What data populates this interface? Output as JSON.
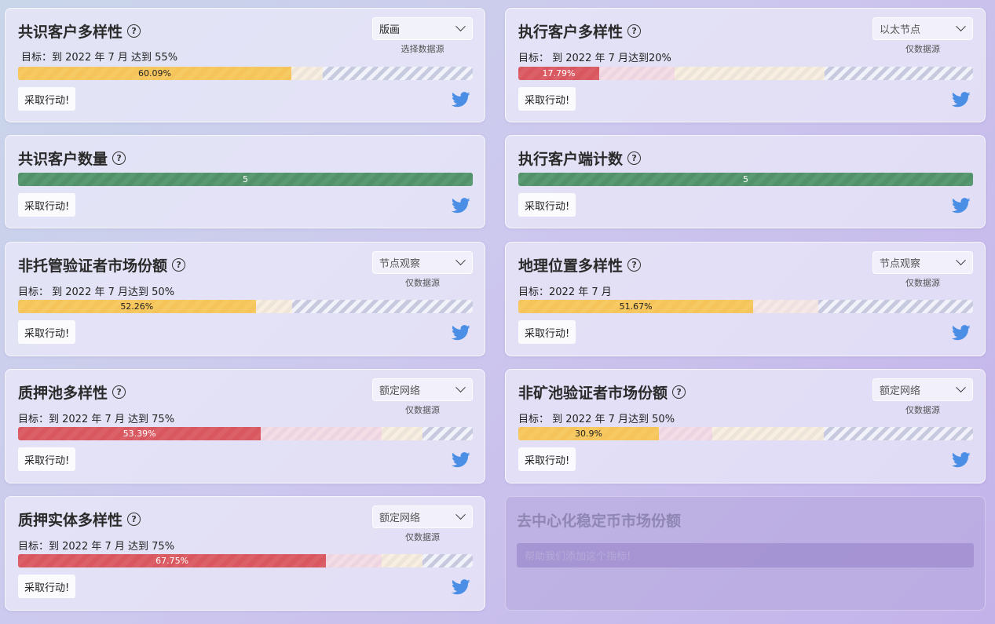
{
  "common": {
    "action_label": "采取行动!",
    "help_glyph": "?"
  },
  "colors": {
    "yellow": "#f5c45a",
    "red": "#d9585f",
    "green": "#53916a",
    "twitter": "#4a8ee6"
  },
  "cards": [
    {
      "title": "共识客户多样性",
      "goal": "目标：到 2022 年 7 月 达到 55%",
      "select": "版画",
      "select_sub": "选择数据源",
      "bar_label": "60.09%",
      "fill_percent": 60.09,
      "color": "yellow"
    },
    {
      "title": "执行客户多样性",
      "goal": "目标： 到 2022 年 7 月达到20%",
      "select": "以太节点",
      "select_sub": "仅数据源",
      "bar_label": "17.79%",
      "fill_percent": 17.79,
      "color": "red"
    },
    {
      "title": "共识客户数量",
      "bar_label": "5",
      "fill_percent": 100,
      "color": "green"
    },
    {
      "title": "执行客户端计数",
      "bar_label": "5",
      "fill_percent": 100,
      "color": "green"
    },
    {
      "title": "非托管验证者市场份额",
      "goal": "目标： 到 2022 年 7 月达到 50%",
      "select": "节点观察",
      "select_sub": "仅数据源",
      "bar_label": "52.26%",
      "fill_percent": 52.26,
      "color": "yellow"
    },
    {
      "title": "地理位置多样性",
      "goal": "目标：2022 年 7 月",
      "select": "节点观察",
      "select_sub": "仅数据源",
      "bar_label": "51.67%",
      "fill_percent": 51.67,
      "color": "yellow"
    },
    {
      "title": "质押池多样性",
      "goal": "目标：到 2022 年 7 月 达到 75%",
      "select": "额定网络",
      "select_sub": "仅数据源",
      "bar_label": "53.39%",
      "fill_percent": 53.39,
      "color": "red"
    },
    {
      "title": "非矿池验证者市场份额",
      "goal": "目标： 到 2022 年 7 月达到 50%",
      "select": "额定网络",
      "select_sub": "仅数据源",
      "bar_label": "30.9%",
      "fill_percent": 30.9,
      "color": "yellow"
    },
    {
      "title": "质押实体多样性",
      "goal": "目标：到 2022 年 7 月 达到 75%",
      "select": "额定网络",
      "select_sub": "仅数据源",
      "bar_label": "67.75%",
      "fill_percent": 67.75,
      "color": "red"
    }
  ],
  "placeholder": {
    "title": "去中心化稳定币市场份额",
    "input_label": "帮助我们添加这个指标!"
  }
}
